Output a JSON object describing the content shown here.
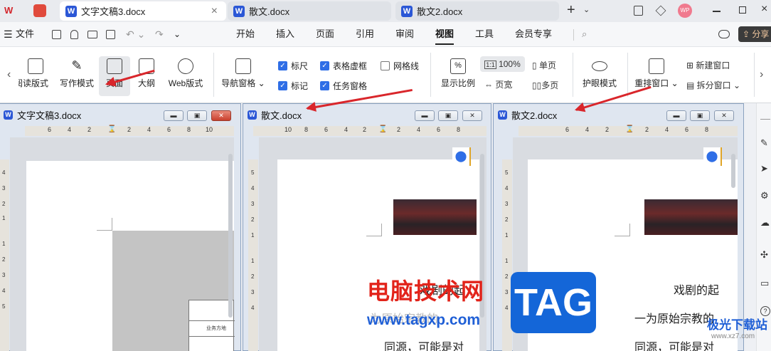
{
  "tabs": [
    {
      "label": "文字文稿3.docx",
      "close": "×"
    },
    {
      "label": "散文.docx"
    },
    {
      "label": "散文2.docx"
    }
  ],
  "menu": {
    "file": "文件",
    "items": [
      "开始",
      "插入",
      "页面",
      "引用",
      "审阅",
      "视图",
      "工具",
      "会员专享"
    ],
    "share": "分享",
    "avatar": "WP"
  },
  "ribbon": {
    "views": [
      "阅读版式",
      "写作模式",
      "页面",
      "大纲",
      "Web版式"
    ],
    "nav": "导航窗格",
    "checks": [
      {
        "label": "标尺",
        "checked": true
      },
      {
        "label": "表格虚框",
        "checked": true
      },
      {
        "label": "网格线",
        "checked": false
      },
      {
        "label": "标记",
        "checked": true
      },
      {
        "label": "任务窗格",
        "checked": true
      }
    ],
    "zoom_label": "显示比例",
    "zoom_value": "100%",
    "page_width": "页宽",
    "single": "单页",
    "multi": "多页",
    "eye": "护眼模式",
    "arrange": "重排窗口",
    "new_window": "新建窗口",
    "split": "拆分窗口"
  },
  "windows": [
    {
      "title": "文字文稿3.docx",
      "ruler": [
        "6",
        "4",
        "2",
        "2",
        "4",
        "6",
        "8",
        "10"
      ],
      "vruler": [
        "4",
        "3",
        "2",
        "1",
        "1",
        "2",
        "3",
        "4",
        "5"
      ],
      "table_text": "业务方地"
    },
    {
      "title": "散文.docx",
      "ruler": [
        "10",
        "8",
        "6",
        "4",
        "2",
        "2",
        "4",
        "6",
        "8"
      ],
      "vruler": [
        "5",
        "4",
        "3",
        "2",
        "1",
        "1",
        "2",
        "3",
        "4"
      ],
      "text1": "戏剧的起",
      "text2": "为原始宗教的",
      "text3": "同源，可能是对"
    },
    {
      "title": "散文2.docx",
      "ruler": [
        "6",
        "4",
        "2",
        "2",
        "4",
        "6",
        "8"
      ],
      "vruler": [
        "5",
        "4",
        "3",
        "2",
        "1",
        "1",
        "2",
        "3",
        "4"
      ],
      "text1": "戏剧的起",
      "text2": "一为原始宗教的",
      "text3": "同源，可能是对"
    }
  ],
  "watermark": {
    "site_cn": "电脑技术网",
    "site_url": "www.tagxp.com",
    "badge": "TAG",
    "corner": "极光下载站",
    "corner_url": "www.xz7.com"
  }
}
